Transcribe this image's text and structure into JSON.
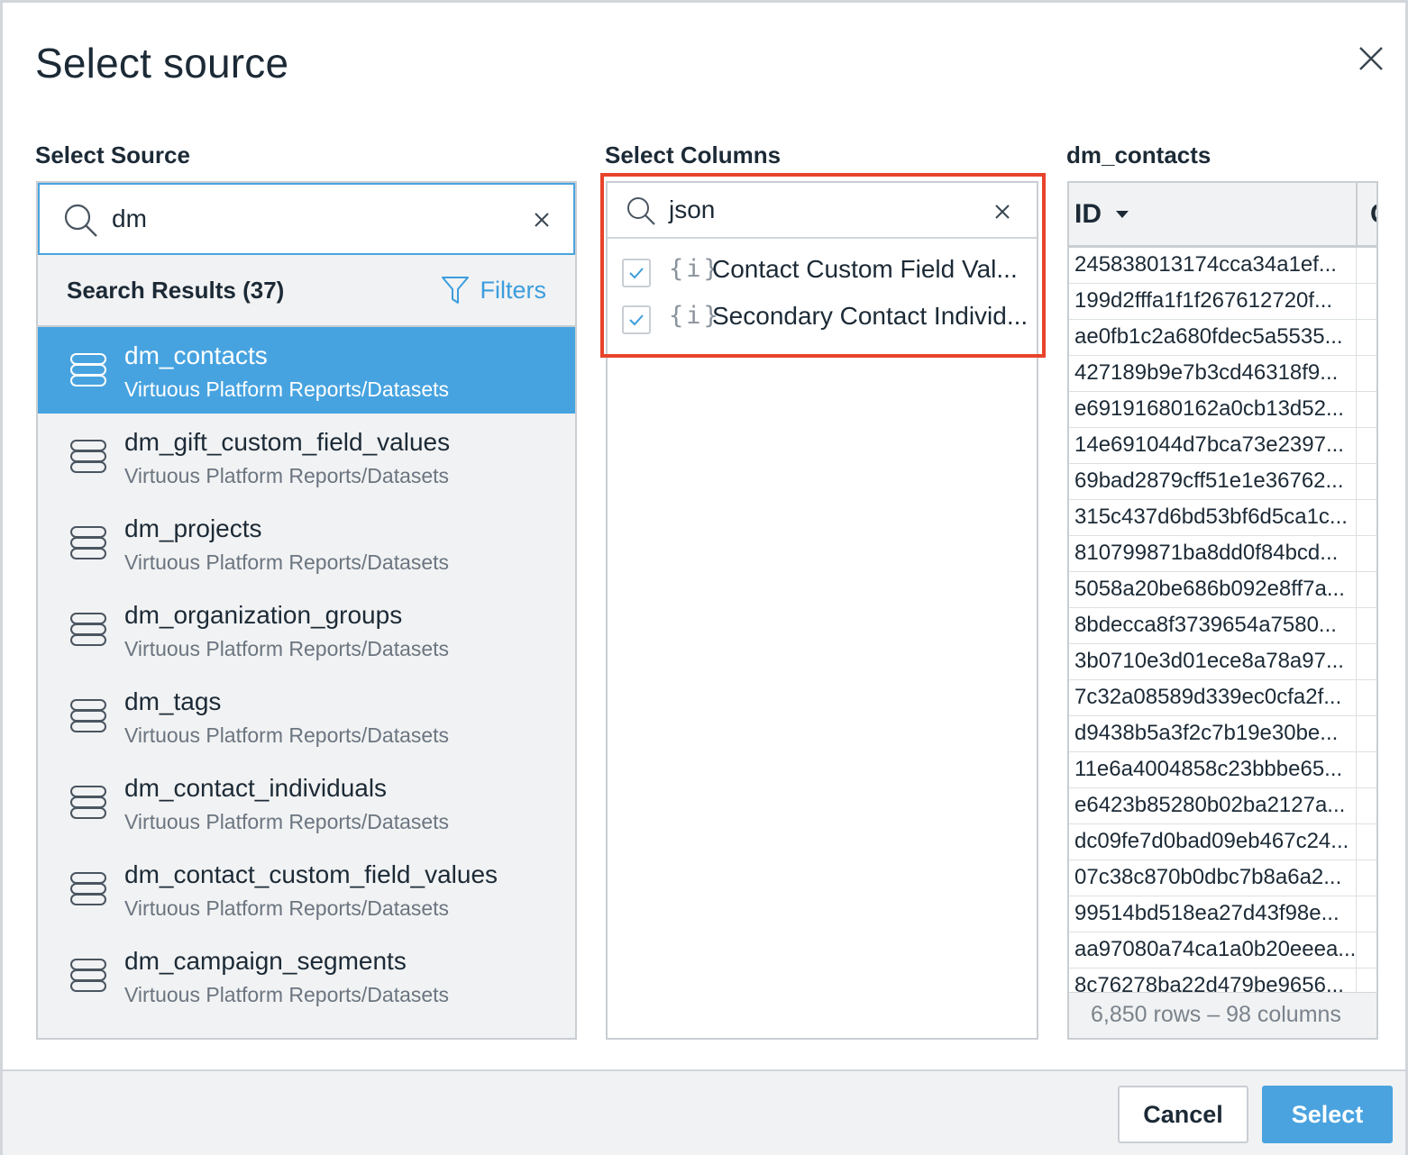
{
  "dialog": {
    "title": "Select source"
  },
  "left": {
    "section_label": "Select Source",
    "search": {
      "value": "dm"
    },
    "results_header": "Search Results (37)",
    "filters_label": "Filters",
    "results": [
      {
        "name": "dm_contacts",
        "path": "Virtuous Platform Reports/Datasets",
        "selected": true
      },
      {
        "name": "dm_gift_custom_field_values",
        "path": "Virtuous Platform Reports/Datasets"
      },
      {
        "name": "dm_projects",
        "path": "Virtuous Platform Reports/Datasets"
      },
      {
        "name": "dm_organization_groups",
        "path": "Virtuous Platform Reports/Datasets"
      },
      {
        "name": "dm_tags",
        "path": "Virtuous Platform Reports/Datasets"
      },
      {
        "name": "dm_contact_individuals",
        "path": "Virtuous Platform Reports/Datasets"
      },
      {
        "name": "dm_contact_custom_field_values",
        "path": "Virtuous Platform Reports/Datasets"
      },
      {
        "name": "dm_campaign_segments",
        "path": "Virtuous Platform Reports/Datasets"
      }
    ]
  },
  "middle": {
    "section_label": "Select Columns",
    "search": {
      "value": "json"
    },
    "columns": [
      {
        "type_icon": "{i}",
        "name": "Contact Custom Field Val...",
        "checked": true
      },
      {
        "type_icon": "{i}",
        "name": "Secondary Contact Individ...",
        "checked": true
      }
    ]
  },
  "preview": {
    "section_label": "dm_contacts",
    "column_header": "ID",
    "next_column_header": "C",
    "rows": [
      "245838013174cca34a1ef...",
      "199d2fffa1f1f267612720f...",
      "ae0fb1c2a680fdec5a5535...",
      "427189b9e7b3cd46318f9...",
      "e69191680162a0cb13d52...",
      "14e691044d7bca73e2397...",
      "69bad2879cff51e1e36762...",
      "315c437d6bd53bf6d5ca1c...",
      "810799871ba8dd0f84bcd...",
      "5058a20be686b092e8ff7a...",
      "8bdecca8f3739654a7580...",
      "3b0710e3d01ece8a78a97...",
      "7c32a08589d339ec0cfa2f...",
      "d9438b5a3f2c7b19e30be...",
      "11e6a4004858c23bbbe65...",
      "e6423b85280b02ba2127a...",
      "dc09fe7d0bad09eb467c24...",
      "07c38c870b0dbc7b8a6a2...",
      "99514bd518ea27d43f98e...",
      "aa97080a74ca1a0b20eeea...",
      "8c76278ba22d479be9656..."
    ],
    "footer": "6,850 rows – 98 columns"
  },
  "footer": {
    "cancel_label": "Cancel",
    "select_label": "Select"
  },
  "colors": {
    "accent": "#4aa3df",
    "selected_row": "#47a3e0",
    "highlight": "#e8432b"
  }
}
